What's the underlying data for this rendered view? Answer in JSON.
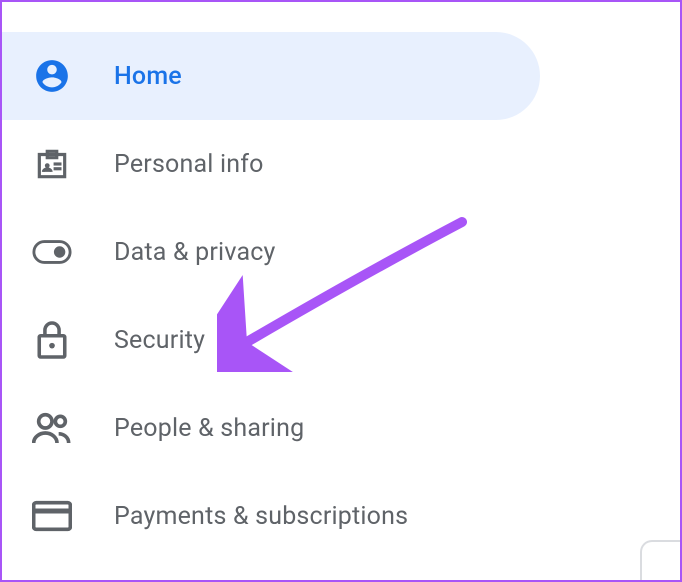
{
  "sidebar": {
    "items": [
      {
        "label": "Home",
        "icon": "person-circle-icon",
        "active": true
      },
      {
        "label": "Personal info",
        "icon": "badge-icon",
        "active": false
      },
      {
        "label": "Data & privacy",
        "icon": "toggle-icon",
        "active": false
      },
      {
        "label": "Security",
        "icon": "lock-icon",
        "active": false
      },
      {
        "label": "People & sharing",
        "icon": "people-icon",
        "active": false
      },
      {
        "label": "Payments & subscriptions",
        "icon": "card-icon",
        "active": false
      }
    ]
  },
  "annotation": {
    "type": "arrow",
    "color": "#a855f7",
    "points_to": "Security"
  }
}
